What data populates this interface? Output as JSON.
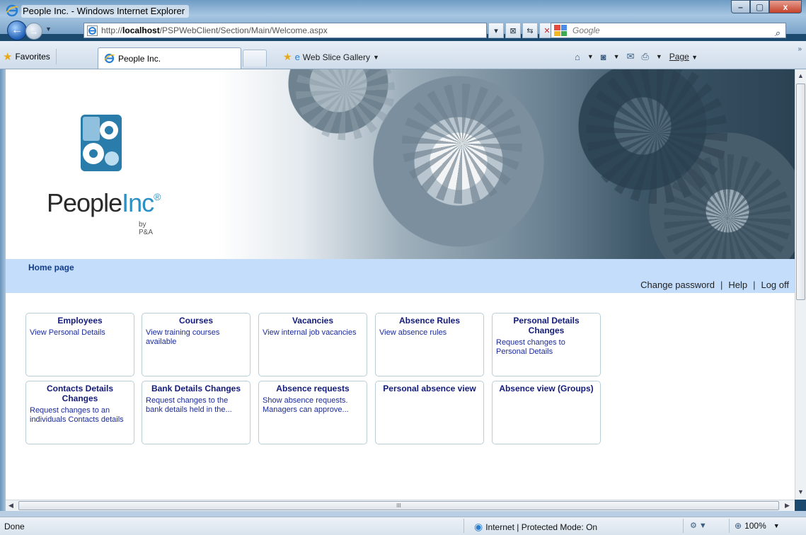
{
  "window": {
    "title": "People Inc. - Windows Internet Explorer",
    "minimize": "–",
    "maximize": "▢",
    "close": "x"
  },
  "addressbar": {
    "url_prefix": "http://",
    "url_host": "localhost",
    "url_path": "/PSPWebClient/Section/Main/Welcome.aspx",
    "search_placeholder": "Google"
  },
  "tabs": {
    "favorites_label": "Favorites",
    "active_tab_label": "People Inc.",
    "web_slice_label": "Web Slice Gallery",
    "page_menu_label": "Page"
  },
  "header": {
    "logo_people": "People",
    "logo_inc": "Inc",
    "logo_reg": "®",
    "logo_sub": "by P&A"
  },
  "nav": {
    "home_link": "Home page",
    "change_password": "Change password",
    "help": "Help",
    "log_off": "Log off",
    "separator": "|"
  },
  "cards": [
    {
      "title": "Employees",
      "desc": "View Personal Details"
    },
    {
      "title": "Courses",
      "desc": "View training courses available"
    },
    {
      "title": "Vacancies",
      "desc": "View internal job vacancies"
    },
    {
      "title": "Absence Rules",
      "desc": "View absence rules"
    },
    {
      "title": "Personal Details Changes",
      "desc": "Request changes to Personal Details"
    },
    {
      "title": "Contacts Details Changes",
      "desc": "Request changes to an individuals Contacts details"
    },
    {
      "title": "Bank Details Changes",
      "desc": "Request changes to the bank details held in the..."
    },
    {
      "title": "Absence requests",
      "desc": "Show absence requests. Managers can approve..."
    },
    {
      "title": "Personal absence view",
      "desc": ""
    },
    {
      "title": "Absence view (Groups)",
      "desc": ""
    }
  ],
  "statusbar": {
    "status_text": "Done",
    "zone_text": "Internet | Protected Mode: On",
    "zoom_text": "100%"
  }
}
